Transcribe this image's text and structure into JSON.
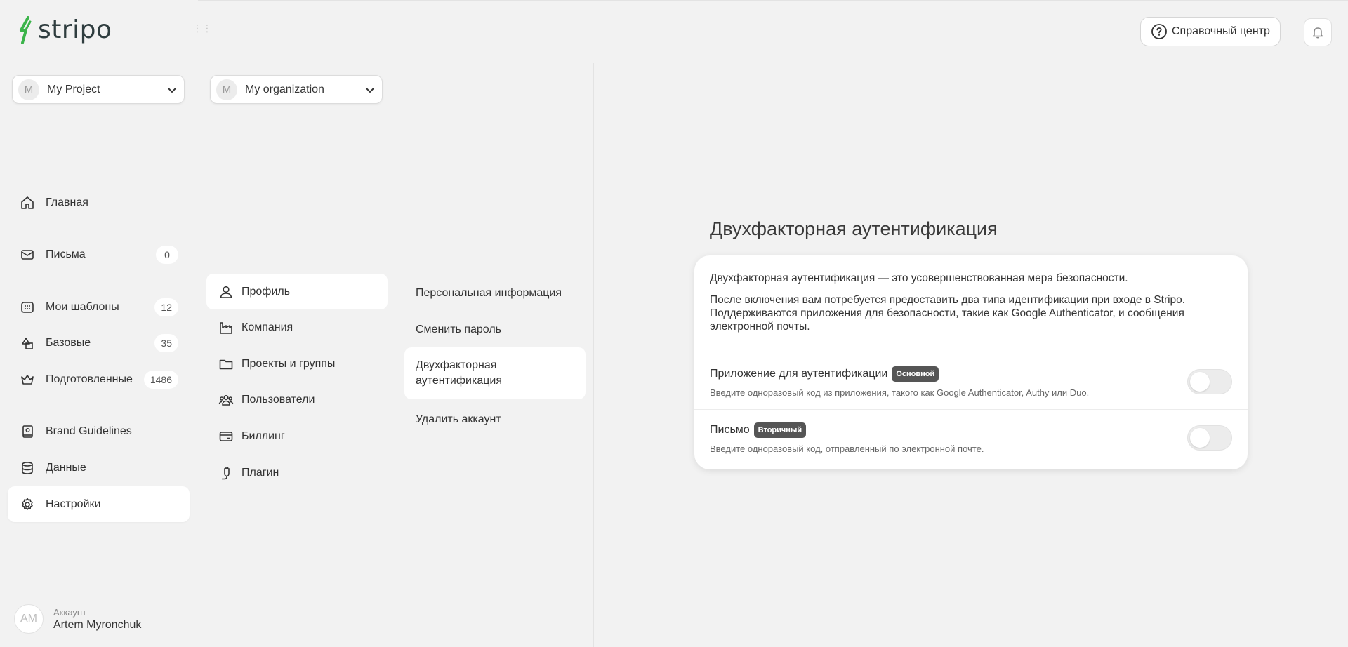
{
  "brand": {
    "name": "stripo",
    "accent": "#3bb44a"
  },
  "project_selector": {
    "initial": "M",
    "label": "My Project"
  },
  "org_selector": {
    "initial": "M",
    "label": "My organization"
  },
  "sidebar": {
    "items": [
      {
        "label": "Главная",
        "icon": "home-icon"
      },
      {
        "label": "Письма",
        "icon": "mail-icon",
        "count": "0"
      },
      {
        "label": "Мои шаблоны",
        "icon": "templates-icon",
        "count": "12"
      },
      {
        "label": "Базовые",
        "icon": "shapes-icon",
        "count": "35"
      },
      {
        "label": "Подготовленные",
        "icon": "crown-icon",
        "count": "1486"
      },
      {
        "label": "Brand Guidelines",
        "icon": "brand-book-icon"
      },
      {
        "label": "Данные",
        "icon": "database-icon"
      },
      {
        "label": "Настройки",
        "icon": "gear-icon",
        "active": true
      }
    ]
  },
  "account": {
    "initials": "AM",
    "caption": "Аккаунт",
    "name": "Artem Myronchuk"
  },
  "header": {
    "help_label": "Справочный центр"
  },
  "settings_menu": {
    "items": [
      {
        "label": "Профиль",
        "active": true
      },
      {
        "label": "Компания"
      },
      {
        "label": "Проекты и группы"
      },
      {
        "label": "Пользователи"
      },
      {
        "label": "Биллинг"
      },
      {
        "label": "Плагин"
      }
    ]
  },
  "profile_menu": {
    "items": [
      {
        "label": "Персональная информация"
      },
      {
        "label": "Сменить пароль"
      },
      {
        "label": "Двухфакторная аутентификация",
        "active": true
      },
      {
        "label": "Удалить аккаунт"
      }
    ]
  },
  "main": {
    "title": "Двухфакторная аутентификация",
    "intro": "Двухфакторная аутентификация — это усовершенствованная мера безопасности.",
    "details": "После включения вам потребуется предоставить два типа идентификации при входе в Stripo. Поддерживаются приложения для безопасности, такие как Google Authenticator, и сообщения электронной почты.",
    "options": [
      {
        "title": "Приложение для аутентификации",
        "badge": "Основной",
        "description": "Введите одноразовый код из приложения, такого как Google Authenticator, Authy или Duo.",
        "enabled": false
      },
      {
        "title": "Письмо",
        "badge": "Вторичный",
        "description": "Введите одноразовый код, отправленный по электронной почте.",
        "enabled": false
      }
    ]
  }
}
